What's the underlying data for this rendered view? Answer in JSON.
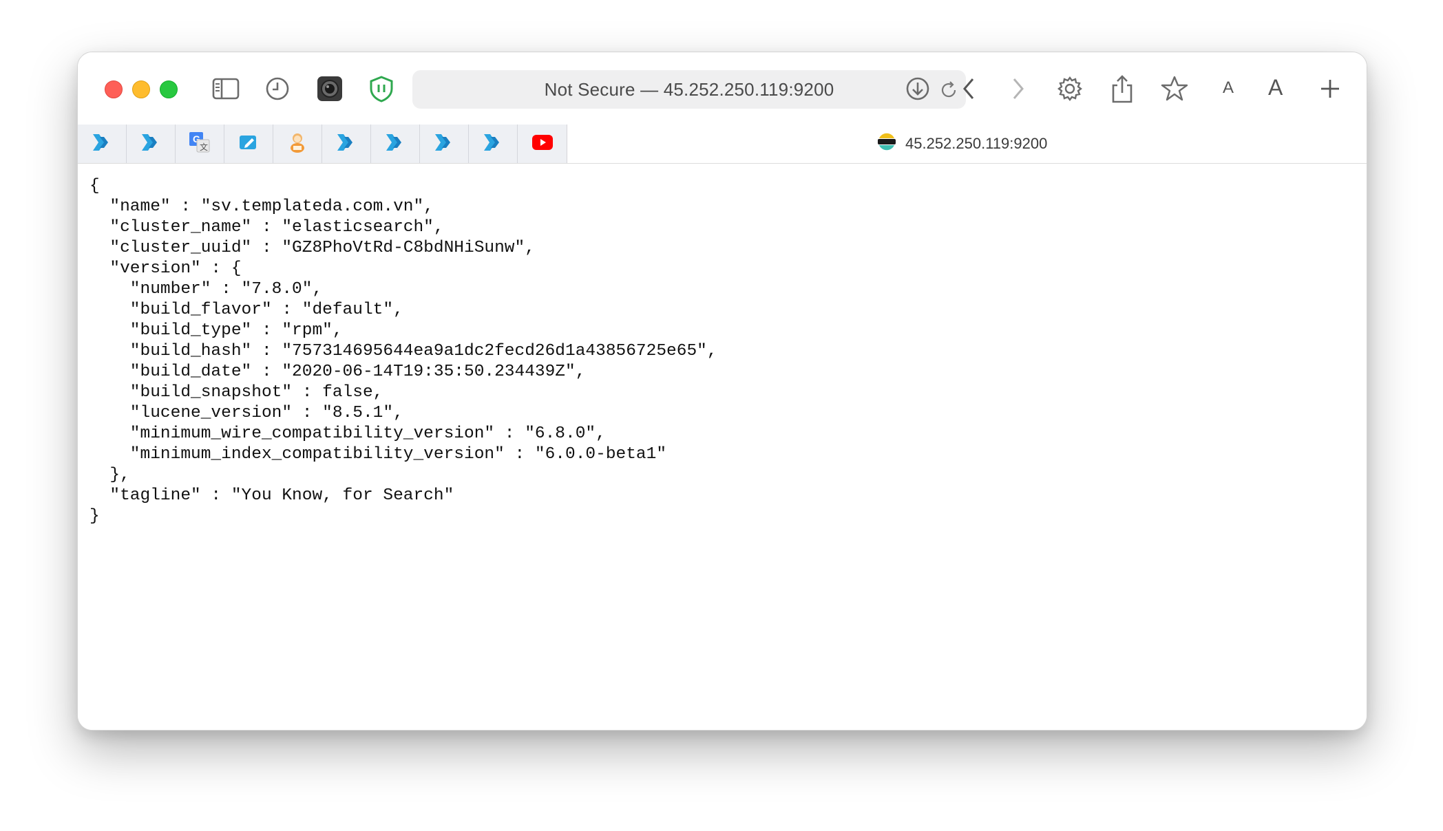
{
  "window": {
    "address_bar": {
      "text": "Not Secure — 45.252.250.119:9200"
    },
    "toolbar_text_small": "A",
    "toolbar_text_large": "A"
  },
  "bookmarks": {
    "items": [
      {
        "icon": "double-chevron-icon"
      },
      {
        "icon": "double-chevron-icon"
      },
      {
        "icon": "google-translate-icon"
      },
      {
        "icon": "note-edit-icon"
      },
      {
        "icon": "character-avatar-icon"
      },
      {
        "icon": "double-chevron-icon"
      },
      {
        "icon": "double-chevron-icon"
      },
      {
        "icon": "double-chevron-icon"
      },
      {
        "icon": "double-chevron-icon"
      },
      {
        "icon": "youtube-icon"
      }
    ]
  },
  "tab": {
    "title": "45.252.250.119:9200",
    "icon": "elasticsearch-favicon-icon"
  },
  "content": {
    "json_text": "{\n  \"name\" : \"sv.templateda.com.vn\",\n  \"cluster_name\" : \"elasticsearch\",\n  \"cluster_uuid\" : \"GZ8PhoVtRd-C8bdNHiSunw\",\n  \"version\" : {\n    \"number\" : \"7.8.0\",\n    \"build_flavor\" : \"default\",\n    \"build_type\" : \"rpm\",\n    \"build_hash\" : \"757314695644ea9a1dc2fecd26d1a43856725e65\",\n    \"build_date\" : \"2020-06-14T19:35:50.234439Z\",\n    \"build_snapshot\" : false,\n    \"lucene_version\" : \"8.5.1\",\n    \"minimum_wire_compatibility_version\" : \"6.8.0\",\n    \"minimum_index_compatibility_version\" : \"6.0.0-beta1\"\n  },\n  \"tagline\" : \"You Know, for Search\"\n}"
  },
  "colors": {
    "accent_blue": "#2aa4e0",
    "youtube_red": "#ff0000",
    "shield_green": "#2fa84f"
  }
}
